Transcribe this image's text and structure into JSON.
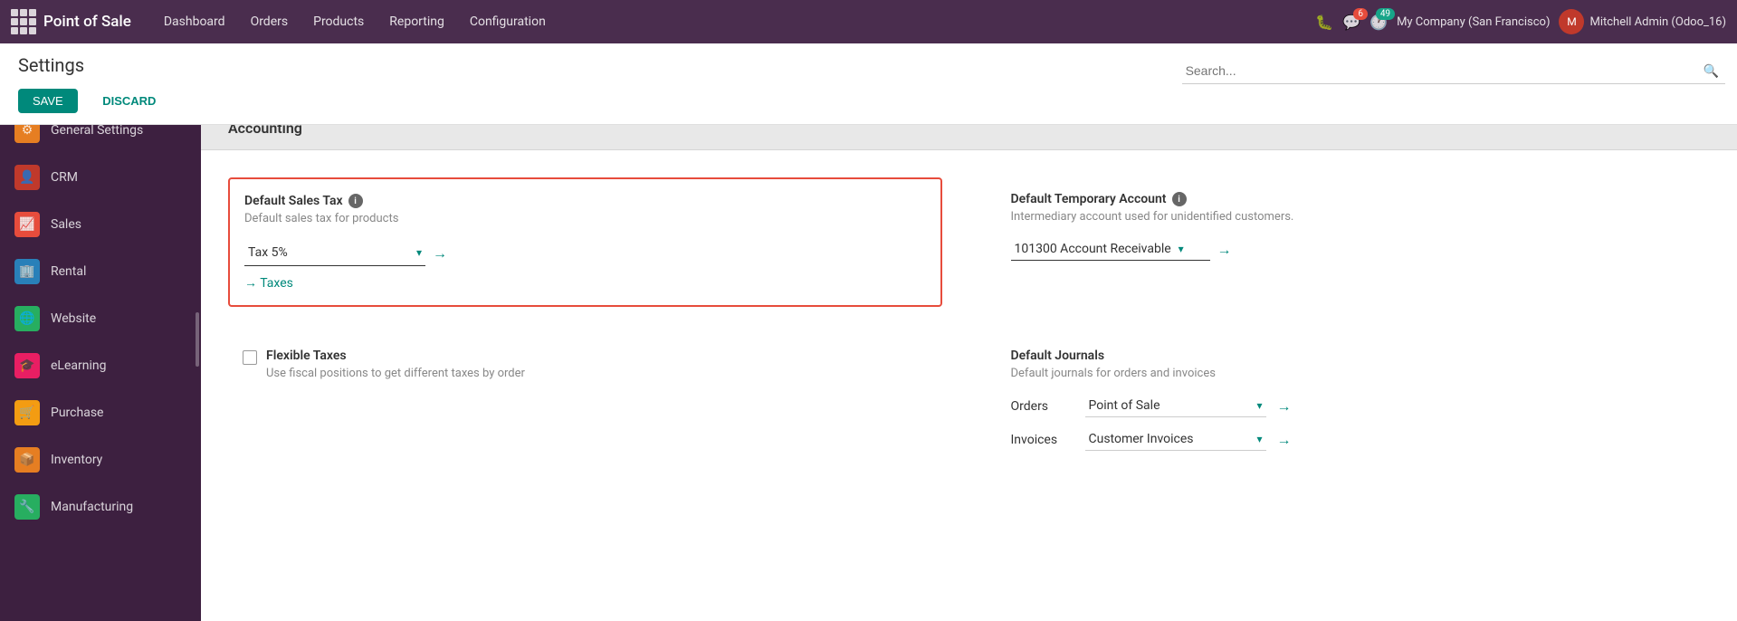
{
  "nav": {
    "app_name": "Point of Sale",
    "menu_items": [
      "Dashboard",
      "Orders",
      "Products",
      "Reporting",
      "Configuration"
    ],
    "badge_messages": "6",
    "badge_clock": "49",
    "company": "My Company (San Francisco)",
    "user": "Mitchell Admin (Odoo_16)"
  },
  "header": {
    "title": "Settings",
    "save_label": "SAVE",
    "discard_label": "DISCARD",
    "search_placeholder": "Search..."
  },
  "sidebar": {
    "items": [
      {
        "id": "general-settings",
        "label": "General Settings",
        "icon": "⚙",
        "icon_class": "icon-general"
      },
      {
        "id": "crm",
        "label": "CRM",
        "icon": "👤",
        "icon_class": "icon-crm"
      },
      {
        "id": "sales",
        "label": "Sales",
        "icon": "📈",
        "icon_class": "icon-sales"
      },
      {
        "id": "rental",
        "label": "Rental",
        "icon": "🏢",
        "icon_class": "icon-rental"
      },
      {
        "id": "website",
        "label": "Website",
        "icon": "🌐",
        "icon_class": "icon-website"
      },
      {
        "id": "elearning",
        "label": "eLearning",
        "icon": "🎓",
        "icon_class": "icon-elearning"
      },
      {
        "id": "purchase",
        "label": "Purchase",
        "icon": "🛒",
        "icon_class": "icon-purchase"
      },
      {
        "id": "inventory",
        "label": "Inventory",
        "icon": "📦",
        "icon_class": "icon-inventory"
      },
      {
        "id": "manufacturing",
        "label": "Manufacturing",
        "icon": "🔧",
        "icon_class": "icon-manufacturing"
      }
    ]
  },
  "main": {
    "section_title": "Accounting",
    "default_sales_tax": {
      "label": "Default Sales Tax",
      "description": "Default sales tax for products",
      "value": "Tax 5%"
    },
    "taxes_link": "→ Taxes",
    "flexible_taxes": {
      "label": "Flexible Taxes",
      "description": "Use fiscal positions to get different taxes by order"
    },
    "default_temporary_account": {
      "label": "Default Temporary Account",
      "description": "Intermediary account used for unidentified customers.",
      "value": "101300 Account Receivable"
    },
    "default_journals": {
      "label": "Default Journals",
      "description": "Default journals for orders and invoices",
      "orders_label": "Orders",
      "orders_value": "Point of Sale",
      "invoices_label": "Invoices",
      "invoices_value": "Customer Invoices"
    }
  }
}
